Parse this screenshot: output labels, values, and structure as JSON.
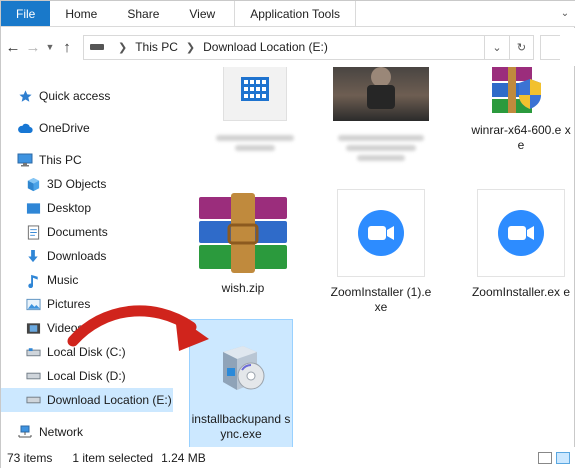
{
  "ribbon": {
    "tabs": [
      "File",
      "Home",
      "Share",
      "View",
      "Application Tools"
    ]
  },
  "address": {
    "segments": [
      "This PC",
      "Download Location (E:)"
    ]
  },
  "nav": {
    "items": [
      {
        "label": "Quick access",
        "icon": "star-icon"
      },
      {
        "label": "OneDrive",
        "icon": "cloud-icon"
      },
      {
        "label": "This PC",
        "icon": "monitor-icon"
      },
      {
        "label": "3D Objects",
        "icon": "cube-icon"
      },
      {
        "label": "Desktop",
        "icon": "desktop-icon"
      },
      {
        "label": "Documents",
        "icon": "documents-icon"
      },
      {
        "label": "Downloads",
        "icon": "download-icon"
      },
      {
        "label": "Music",
        "icon": "music-icon"
      },
      {
        "label": "Pictures",
        "icon": "pictures-icon"
      },
      {
        "label": "Videos",
        "icon": "videos-icon"
      },
      {
        "label": "Local Disk (C:)",
        "icon": "drive-icon"
      },
      {
        "label": "Local Disk (D:)",
        "icon": "drive-icon"
      },
      {
        "label": "Download Location (E:)",
        "icon": "drive-icon"
      },
      {
        "label": "Network",
        "icon": "network-icon"
      }
    ]
  },
  "files": {
    "winrar": "winrar-x64-600.e xe",
    "wish": "wish.zip",
    "zoom1": "ZoomInstaller (1).exe",
    "zoom2": "ZoomInstaller.ex e",
    "installer": "installbackupand sync.exe"
  },
  "status": {
    "items": "73 items",
    "selected": "1 item selected",
    "size": "1.24 MB"
  },
  "colors": {
    "accent": "#1979ca",
    "selection": "#cce8ff",
    "zoom": "#2d8cff",
    "arrow": "#d0241c"
  }
}
